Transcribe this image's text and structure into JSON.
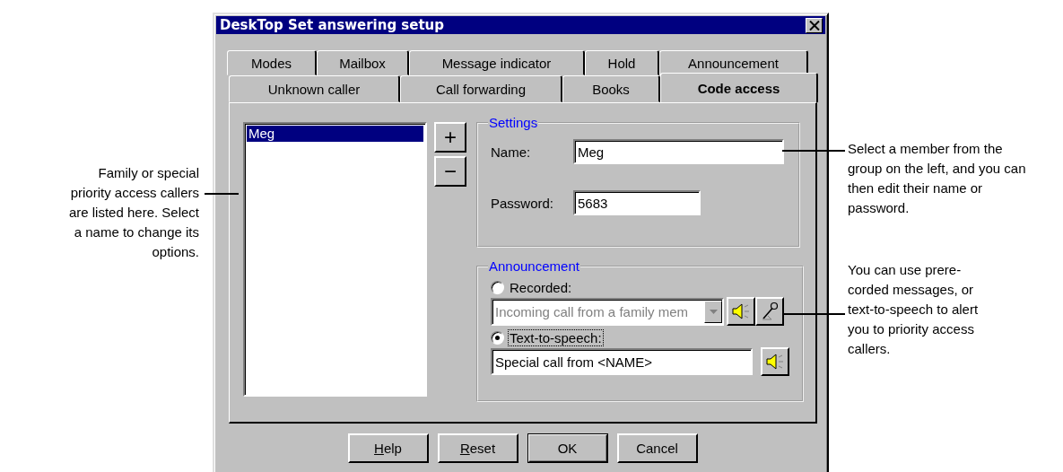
{
  "window": {
    "title": "DeskTop Set answering setup"
  },
  "tab_rows": [
    [
      {
        "label": "Modes",
        "selected": false
      },
      {
        "label": "Mailbox",
        "selected": false
      },
      {
        "label": "Message indicator",
        "selected": false
      },
      {
        "label": "Hold",
        "selected": false
      },
      {
        "label": "Announcement",
        "selected": false
      }
    ],
    [
      {
        "label": "Unknown caller",
        "selected": false
      },
      {
        "label": "Call forwarding",
        "selected": false
      },
      {
        "label": "Books",
        "selected": false
      },
      {
        "label": "Code access",
        "selected": true
      }
    ]
  ],
  "members": [
    {
      "name": "Meg",
      "selected": true
    }
  ],
  "member_buttons": [
    "+",
    "−"
  ],
  "settings": {
    "title": "Settings",
    "name_label": "Name:",
    "name_value": "Meg",
    "password_label": "Password:",
    "password_value": "5683"
  },
  "announcement": {
    "title": "Announcement",
    "options": [
      {
        "label": "Recorded:",
        "selected": false,
        "kind": "dropdown",
        "value": "Incoming call from a family mem",
        "disabled": true
      },
      {
        "label": "Text-to-speech:",
        "selected": true,
        "kind": "text",
        "value": "Special call from <NAME>",
        "disabled": false
      }
    ]
  },
  "buttons": [
    {
      "label": "Help",
      "underline_first": true,
      "default": false
    },
    {
      "label": "Reset",
      "underline_first": true,
      "default": false
    },
    {
      "label": "OK",
      "underline_first": false,
      "default": true
    },
    {
      "label": "Cancel",
      "underline_first": false,
      "default": false
    }
  ],
  "left_annotations": [
    "Family or special priority access callers are listed here. Select a name to change its options."
  ],
  "right_annotations": [
    "Select a member from the group on the left, and you can then edit their name or password.",
    "You can use prere-corded messages, or text-to-speech to alert you to priority access callers."
  ]
}
